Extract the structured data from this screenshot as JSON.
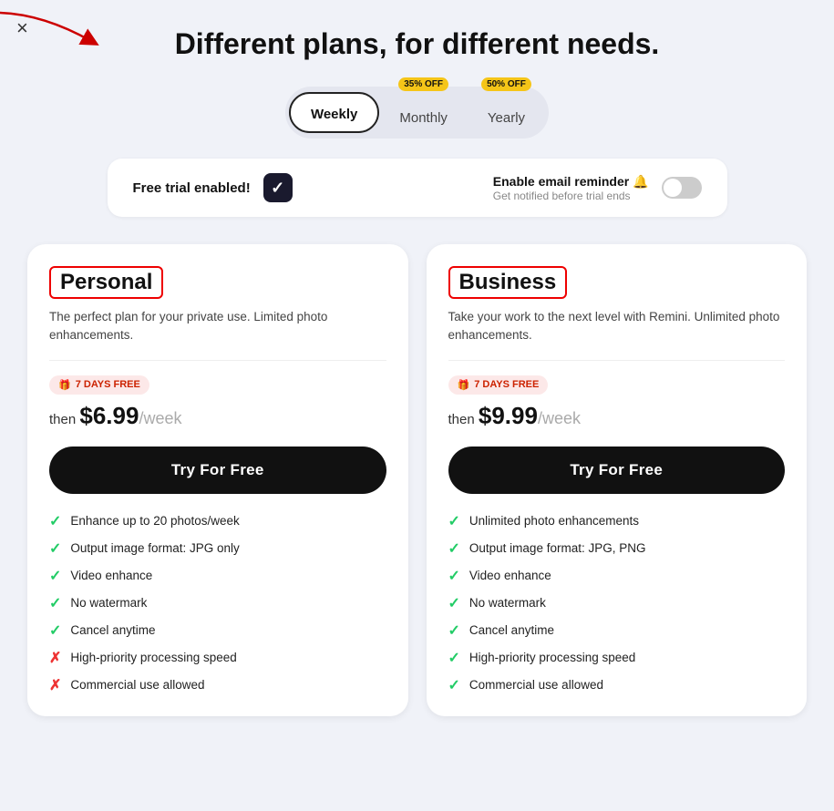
{
  "page": {
    "title": "Different plans, for different needs.",
    "close_label": "×"
  },
  "billing": {
    "tabs": [
      {
        "id": "weekly",
        "label": "Weekly",
        "active": true,
        "badge": null
      },
      {
        "id": "monthly",
        "label": "Monthly",
        "active": false,
        "badge": "35% OFF"
      },
      {
        "id": "yearly",
        "label": "Yearly",
        "active": false,
        "badge": "50% OFF"
      }
    ]
  },
  "free_trial_bar": {
    "label": "Free trial enabled!",
    "email_reminder_label": "Enable email reminder 🔔",
    "email_reminder_sub": "Get notified before trial ends"
  },
  "plans": [
    {
      "id": "personal",
      "name": "Personal",
      "desc": "The perfect plan for your private use. Limited photo enhancements.",
      "free_days": "7 DAYS FREE",
      "price_prefix": "then",
      "price_amount": "$6.99",
      "price_period": "/week",
      "cta": "Try For Free",
      "features": [
        {
          "text": "Enhance up to 20 photos/week",
          "included": true
        },
        {
          "text": "Output image format: JPG only",
          "included": true
        },
        {
          "text": "Video enhance",
          "included": true
        },
        {
          "text": "No watermark",
          "included": true
        },
        {
          "text": "Cancel anytime",
          "included": true
        },
        {
          "text": "High-priority processing speed",
          "included": false
        },
        {
          "text": "Commercial use allowed",
          "included": false
        }
      ]
    },
    {
      "id": "business",
      "name": "Business",
      "desc": "Take your work to the next level with Remini. Unlimited photo enhancements.",
      "free_days": "7 DAYS FREE",
      "price_prefix": "then",
      "price_amount": "$9.99",
      "price_period": "/week",
      "cta": "Try For Free",
      "features": [
        {
          "text": "Unlimited photo enhancements",
          "included": true
        },
        {
          "text": "Output image format: JPG, PNG",
          "included": true
        },
        {
          "text": "Video enhance",
          "included": true
        },
        {
          "text": "No watermark",
          "included": true
        },
        {
          "text": "Cancel anytime",
          "included": true
        },
        {
          "text": "High-priority processing speed",
          "included": true
        },
        {
          "text": "Commercial use allowed",
          "included": true
        }
      ]
    }
  ]
}
